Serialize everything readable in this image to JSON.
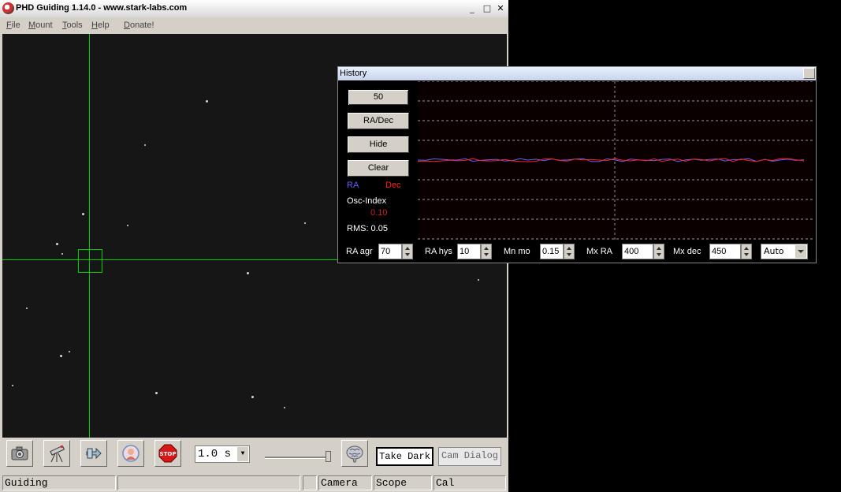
{
  "app": {
    "title": "PHD Guiding 1.14.0  -  www.stark-labs.com",
    "window_controls": {
      "minimize": "_",
      "maximize": "□",
      "close": "✕"
    }
  },
  "menu": {
    "items": [
      {
        "label": "File"
      },
      {
        "label": "Mount"
      },
      {
        "label": "Tools"
      },
      {
        "label": "Help"
      },
      {
        "label": "Donate!"
      }
    ]
  },
  "toolbar": {
    "exposure_value": "1.0 s",
    "take_dark_label": "Take Dark",
    "cam_dialog_label": "Cam Dialog",
    "icons": [
      "camera-icon",
      "telescope-icon",
      "loop-icon",
      "phd-logo-icon",
      "stop-icon",
      "brain-icon"
    ]
  },
  "status": {
    "mode": "Guiding",
    "message": "",
    "indicator": "",
    "camera": "Camera",
    "scope": "Scope",
    "cal": "Cal"
  },
  "history": {
    "title": "History",
    "buttons": {
      "length": "50",
      "mode": "RA/Dec",
      "hide": "Hide",
      "clear": "Clear"
    },
    "legend": {
      "ra": "RA",
      "dec": "Dec"
    },
    "osc_label": "Osc-Index",
    "osc_value": "0.10",
    "rms": "RMS: 0.05",
    "colors": {
      "ra": "#6060ff",
      "dec": "#ff2020",
      "grid": "#c8c8c8",
      "osc": "#d02020"
    },
    "params": {
      "ra_agr_label": "RA agr",
      "ra_agr_value": "70",
      "ra_hys_label": "RA hys",
      "ra_hys_value": "10",
      "mn_mo_label": "Mn mo",
      "mn_mo_value": "0.15",
      "mx_ra_label": "Mx RA",
      "mx_ra_value": "400",
      "mx_dec_label": "Mx dec",
      "mx_dec_value": "450",
      "scale_value": "Auto"
    }
  }
}
